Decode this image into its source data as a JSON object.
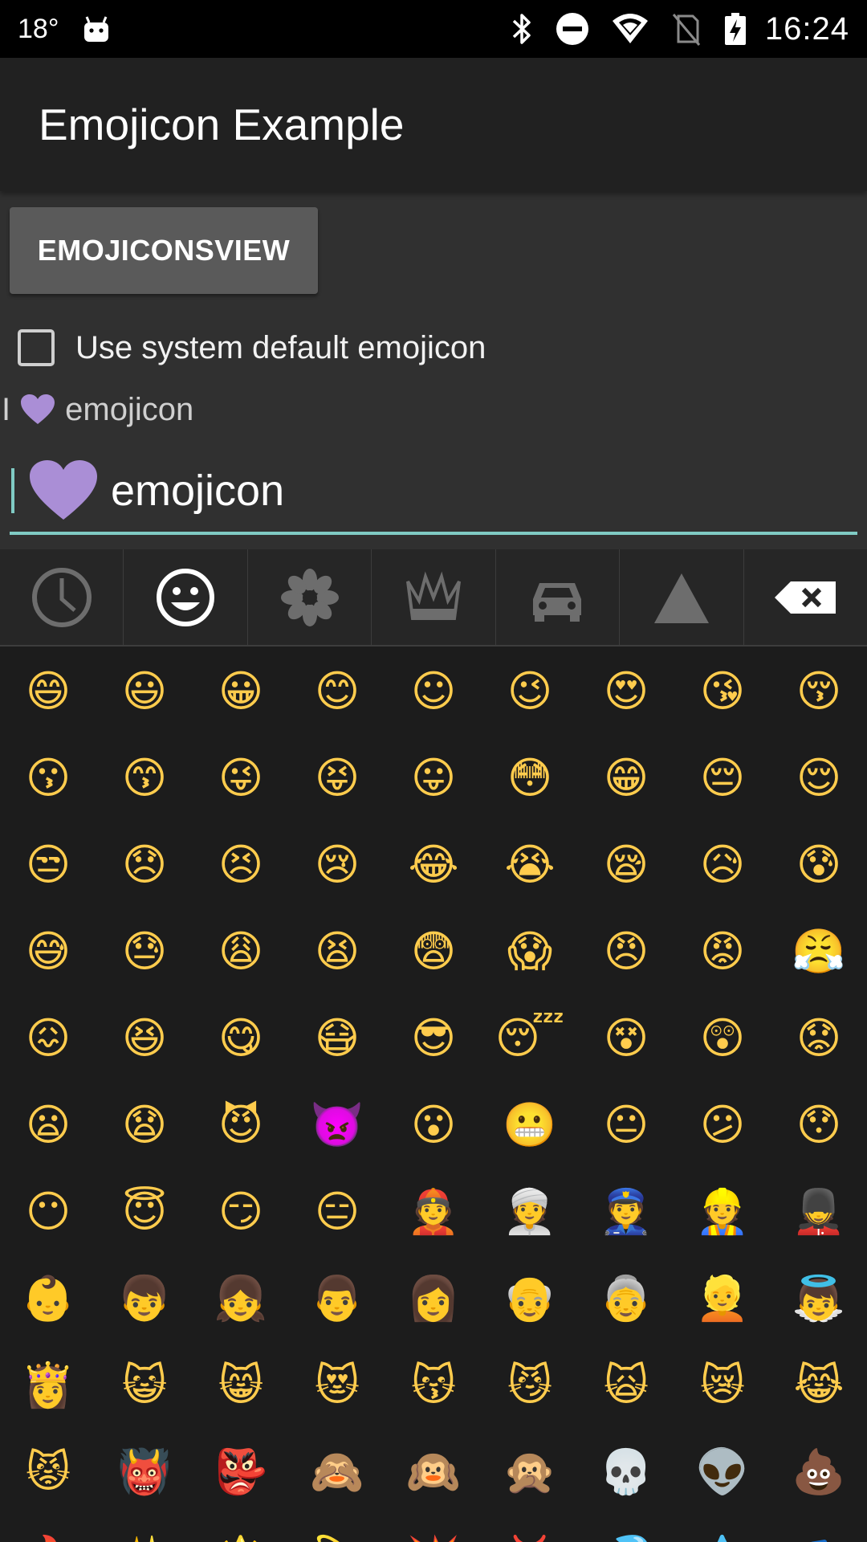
{
  "status_bar": {
    "temperature": "18°",
    "time": "16:24",
    "icons": [
      "android-icon",
      "bluetooth-icon",
      "do-not-disturb-icon",
      "wifi-icon",
      "no-sim-icon",
      "battery-charging-icon"
    ]
  },
  "app_bar": {
    "title": "Emojicon Example"
  },
  "emojicons_button": {
    "label": "EMOJICONSVIEW"
  },
  "system_default_checkbox": {
    "label": "Use system default emojicon",
    "checked": false
  },
  "preview": {
    "prefix": "I",
    "emoji": "purple-heart",
    "suffix": "emojicon"
  },
  "edit_field": {
    "value": "emojicon",
    "emoji": "purple-heart",
    "cursor_color": "#80cbc4"
  },
  "emoji_tabs": [
    {
      "icon": "recent-clock-icon",
      "selected": false
    },
    {
      "icon": "smiley-icon",
      "selected": true
    },
    {
      "icon": "flower-icon",
      "selected": false
    },
    {
      "icon": "crown-icon",
      "selected": false
    },
    {
      "icon": "car-icon",
      "selected": false
    },
    {
      "icon": "symbols-triangle-icon",
      "selected": false
    },
    {
      "icon": "backspace-icon",
      "selected": false
    }
  ],
  "emoji_rows": [
    [
      "😄",
      "😃",
      "😀",
      "😊",
      "☺",
      "😉",
      "😍",
      "😘",
      "😚"
    ],
    [
      "😗",
      "😙",
      "😜",
      "😝",
      "😛",
      "😳",
      "😁",
      "😔",
      "😌"
    ],
    [
      "😒",
      "😞",
      "😣",
      "😢",
      "😂",
      "😭",
      "😪",
      "😥",
      "😰"
    ],
    [
      "😅",
      "😓",
      "😩",
      "😫",
      "😨",
      "😱",
      "😠",
      "😡",
      "😤"
    ],
    [
      "😖",
      "😆",
      "😋",
      "😷",
      "😎",
      "😴",
      "😵",
      "😲",
      "😟"
    ],
    [
      "😦",
      "😧",
      "😈",
      "👿",
      "😮",
      "😬",
      "😐",
      "😕",
      "😯"
    ],
    [
      "😶",
      "😇",
      "😏",
      "😑",
      "👲",
      "👳",
      "👮",
      "👷",
      "💂"
    ],
    [
      "👶",
      "👦",
      "👧",
      "👨",
      "👩",
      "👴",
      "👵",
      "👱",
      "👼"
    ],
    [
      "👸",
      "😺",
      "😸",
      "😻",
      "😽",
      "😼",
      "🙀",
      "😿",
      "😹"
    ],
    [
      "😾",
      "👹",
      "👺",
      "🙈",
      "🙉",
      "🙊",
      "💀",
      "👽",
      "💩"
    ],
    [
      "🔥",
      "✨",
      "🌟",
      "💫",
      "💥",
      "💢",
      "💦",
      "💧",
      "💤"
    ]
  ],
  "colors": {
    "status_bar_bg": "#000000",
    "app_bar_bg": "#212121",
    "content_bg": "#303030",
    "keyboard_bg": "#1c1c1c",
    "accent": "#80cbc4",
    "emoji_yellow": "#ffcc4d",
    "heart_purple": "#aa8ed6"
  }
}
